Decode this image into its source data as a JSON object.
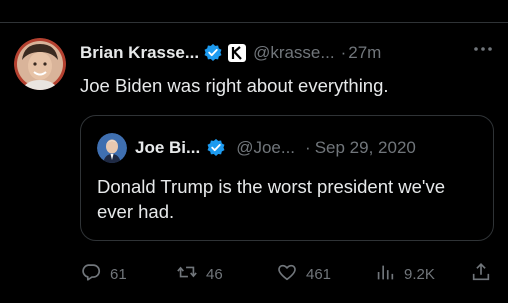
{
  "tweet": {
    "display_name": "Brian Krasse...",
    "handle": "@krasse...",
    "separator": "·",
    "time": "27m",
    "text": "Joe Biden was right about everything.",
    "avatar_icon": "person-avatar",
    "verified_icon": "verified-badge-icon",
    "affiliation_icon": "k-affiliation-icon",
    "more_icon": "more-options-icon"
  },
  "quote": {
    "display_name": "Joe Bi...",
    "handle": "@Joe...",
    "separator": "·",
    "date": "Sep 29, 2020",
    "text": "Donald Trump is the worst president we've ever had.",
    "avatar_icon": "person-avatar",
    "verified_icon": "verified-badge-icon"
  },
  "actions": {
    "replies": "61",
    "retweets": "46",
    "likes": "461",
    "views": "9.2K",
    "icons": [
      "reply-icon",
      "retweet-icon",
      "like-icon",
      "views-icon",
      "share-icon"
    ]
  },
  "colors": {
    "background": "#000000",
    "text": "#e7e9ea",
    "muted": "#71767b",
    "border": "#2f3336",
    "verified": "#1d9bf0"
  }
}
